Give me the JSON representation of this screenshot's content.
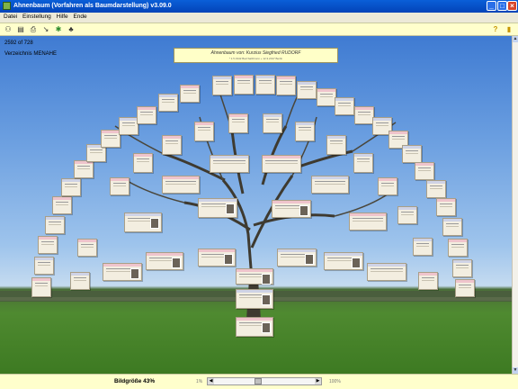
{
  "window": {
    "title": "Ahnenbaum (Vorfahren als Baumdarstellung) v3.09.0"
  },
  "menu": [
    "Datei",
    "Einstellung",
    "Hilfe",
    "Ende"
  ],
  "toolbar": {
    "icons": [
      "people-icon",
      "chart-icon",
      "print-icon",
      "arrow-icon",
      "star-icon",
      "tree-icon"
    ],
    "right_icons": [
      "help-icon",
      "exit-icon"
    ]
  },
  "stats": {
    "count": "2592 of 728",
    "ref": "Verzeichnis MENAHE"
  },
  "header": {
    "title": "Ahnenbaum von: Kurzius Siegfried RUDORF",
    "subtitle": "* 1.5.1942 Bad Salzbrunn + 12.3.2017 Berlin"
  },
  "status": {
    "label": "Bildgröße 43%",
    "min": "1%",
    "max": "100%",
    "zoom_fraction": 0.43
  },
  "colors": {
    "sky": "#6a9ee0",
    "field": "#4f8a30",
    "header_bg": "#ffffc8",
    "status_bg": "#ffffcc",
    "female_strip": "#efc4cc",
    "male_strip": "#cfd3e6"
  }
}
